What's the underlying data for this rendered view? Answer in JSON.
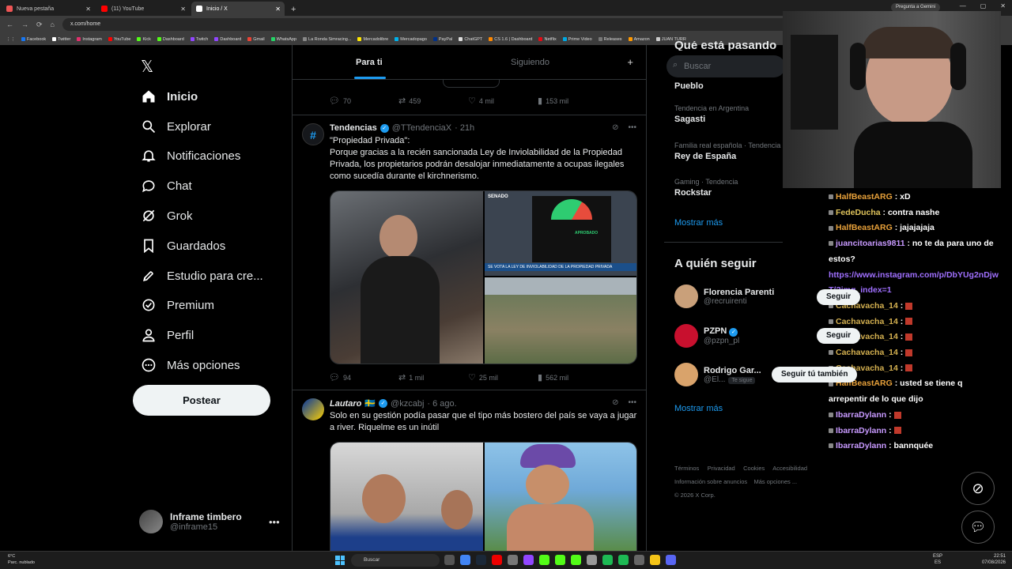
{
  "browser": {
    "tabs": [
      {
        "label": "Nueva pestaña",
        "color": "#e55"
      },
      {
        "label": "(11) YouTube",
        "color": "#f00"
      },
      {
        "label": "Inicio / X",
        "color": "#fff"
      }
    ],
    "gemini": "Pregunta a Gemini",
    "url": "x.com/home",
    "bookmarks": [
      {
        "label": "Facebook",
        "color": "#1877f2"
      },
      {
        "label": "Twitter",
        "color": "#fff"
      },
      {
        "label": "Instagram",
        "color": "#e1306c"
      },
      {
        "label": "YouTube",
        "color": "#f00"
      },
      {
        "label": "Kick",
        "color": "#53fc18"
      },
      {
        "label": "Dashboard",
        "color": "#53fc18"
      },
      {
        "label": "Twitch",
        "color": "#9146ff"
      },
      {
        "label": "Dashboard",
        "color": "#9146ff"
      },
      {
        "label": "Gmail",
        "color": "#ea4335"
      },
      {
        "label": "WhatsApp",
        "color": "#25d366"
      },
      {
        "label": "La Ronda Simracing...",
        "color": "#888"
      },
      {
        "label": "Mercadolibre",
        "color": "#ffe600"
      },
      {
        "label": "Mercadopago",
        "color": "#00b1ea"
      },
      {
        "label": "PayPal",
        "color": "#003087"
      },
      {
        "label": "ChatGPT",
        "color": "#ddd"
      },
      {
        "label": "CS 1.6 | Dashboard",
        "color": "#f80"
      },
      {
        "label": "Netflix",
        "color": "#e50914"
      },
      {
        "label": "Prime Video",
        "color": "#00a8e1"
      },
      {
        "label": "Releases",
        "color": "#777"
      },
      {
        "label": "Amazon",
        "color": "#f90"
      },
      {
        "label": "JUAN TURR",
        "color": "#ccc"
      }
    ]
  },
  "nav": {
    "items": [
      {
        "label": "Inicio",
        "icon": "home-icon"
      },
      {
        "label": "Explorar",
        "icon": "search-icon"
      },
      {
        "label": "Notificaciones",
        "icon": "bell-icon"
      },
      {
        "label": "Chat",
        "icon": "chat-icon"
      },
      {
        "label": "Grok",
        "icon": "grok-icon"
      },
      {
        "label": "Guardados",
        "icon": "bookmark-icon"
      },
      {
        "label": "Estudio para cre...",
        "icon": "rocket-icon"
      },
      {
        "label": "Premium",
        "icon": "premium-icon"
      },
      {
        "label": "Perfil",
        "icon": "person-icon"
      },
      {
        "label": "Más opciones",
        "icon": "more-icon"
      }
    ],
    "post_label": "Postear",
    "account": {
      "name": "Inframe timbero",
      "handle": "@inframe15"
    }
  },
  "feed": {
    "tab_for_you": "Para ti",
    "tab_following": "Siguiendo",
    "top_actions": {
      "replies": "70",
      "reposts": "459",
      "likes": "4 mil",
      "views": "153 mil"
    },
    "tweets": [
      {
        "name": "Tendencias",
        "handle": "@TTendenciaX",
        "time": "· 21h",
        "text": "\"Propiedad Privada\":\nPorque gracias a la recién sancionada Ley de Inviolabilidad de la Propiedad Privada, los propietarios podrán desalojar inmediatamente a ocupas ilegales como sucedía durante el kirchnerismo.",
        "media_caption": "SE VOTA LA LEY DE INVIOLABILIDAD DE LA PROPIEDAD PRIVADA",
        "senado": "SENADO",
        "board_status": "APROBADO",
        "replies": "94",
        "reposts": "1 mil",
        "likes": "25 mil",
        "views": "562 mil"
      },
      {
        "name": "Lautaro",
        "flag": "🇸🇪",
        "handle": "@kzcabj",
        "time": "· 6 ago.",
        "text": "Solo en su gestión podía pasar que el tipo más bostero del país se vaya a jugar a river. Riquelme es un inútil"
      }
    ]
  },
  "sidebar": {
    "search_placeholder": "Buscar",
    "section_title": "Qué está pasando",
    "trends": [
      {
        "category": "",
        "name": "Pueblo"
      },
      {
        "category": "Tendencia en Argentina",
        "name": "Sagasti"
      },
      {
        "category": "Familia real española · Tendencia",
        "name": "Rey de España"
      },
      {
        "category": "Gaming · Tendencia",
        "name": "Rockstar"
      }
    ],
    "show_more": "Mostrar más",
    "who_title": "A quién seguir",
    "who": [
      {
        "name": "Florencia Parenti",
        "handle": "@recruirenti",
        "color": "#c9a07a"
      },
      {
        "name": "PZPN",
        "handle": "@pzpn_pl",
        "color": "#c8102e",
        "verified": true
      },
      {
        "name": "Rodrigo Gar...",
        "handle": "@El...",
        "color": "#d9a36b",
        "badge": "Te sigue"
      }
    ],
    "follow": "Seguir",
    "follow_back": "Seguir tú también",
    "show_more2": "Mostrar más",
    "footer": [
      "Términos",
      "Privacidad",
      "Cookies",
      "Accesibilidad",
      "Información sobre anuncios",
      "Más opciones ...",
      "© 2026 X Corp."
    ]
  },
  "chat": {
    "messages": [
      {
        "user": "HalfBeastARG",
        "text": ": xD",
        "cls": "u"
      },
      {
        "user": "FedeDucha",
        "text": ": contra nashe",
        "cls": "u4"
      },
      {
        "user": "HalfBeastARG",
        "text": ": jajajajaja",
        "cls": "u"
      },
      {
        "user": "juancitoarias9811",
        "text": ": no te da para uno de estos?",
        "cls": "u3"
      },
      {
        "user": "",
        "text": "https://www.instagram.com/p/DbYUg2nDjwT/?img_index=1",
        "cls": "lnk"
      },
      {
        "user": "Cachavacha_14",
        "text": ":",
        "cls": "u2"
      },
      {
        "user": "Cachavacha_14",
        "text": ":",
        "cls": "u2"
      },
      {
        "user": "Cachavacha_14",
        "text": ":",
        "cls": "u2"
      },
      {
        "user": "Cachavacha_14",
        "text": ":",
        "cls": "u2"
      },
      {
        "user": "Cachavacha_14",
        "text": ":",
        "cls": "u2"
      },
      {
        "user": "HalfBeastARG",
        "text": ": usted se tiene q arrepentir de lo que dijo",
        "cls": "u"
      },
      {
        "user": "IbarraDylann",
        "text": ":",
        "cls": "u3"
      },
      {
        "user": "IbarraDylann",
        "text": ":",
        "cls": "u3"
      },
      {
        "user": "IbarraDylann",
        "text": ": bannquée",
        "cls": "u3"
      }
    ]
  },
  "taskbar": {
    "weather_temp": "6°C",
    "weather_desc": "Parc. nublado",
    "search": "Buscar",
    "lang1": "ESP",
    "lang2": "ES",
    "time": "22:51",
    "date": "07/08/2026"
  }
}
